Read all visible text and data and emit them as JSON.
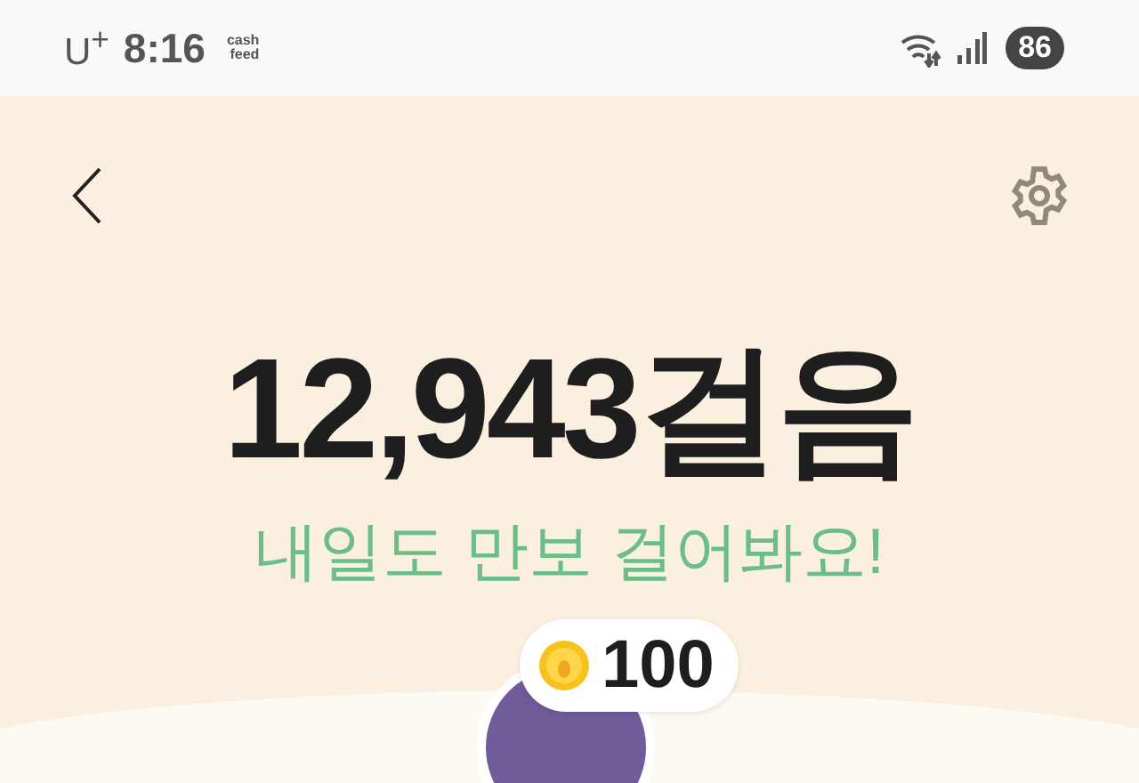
{
  "status_bar": {
    "carrier": "U$^{+}$",
    "time": "8:16",
    "app_logo": [
      "cash",
      "feed"
    ],
    "battery": "86"
  },
  "steps": {
    "count": "12,943걸음",
    "message": "내일도 만보 걸어봐요!"
  },
  "reward": {
    "amount": "100"
  }
}
